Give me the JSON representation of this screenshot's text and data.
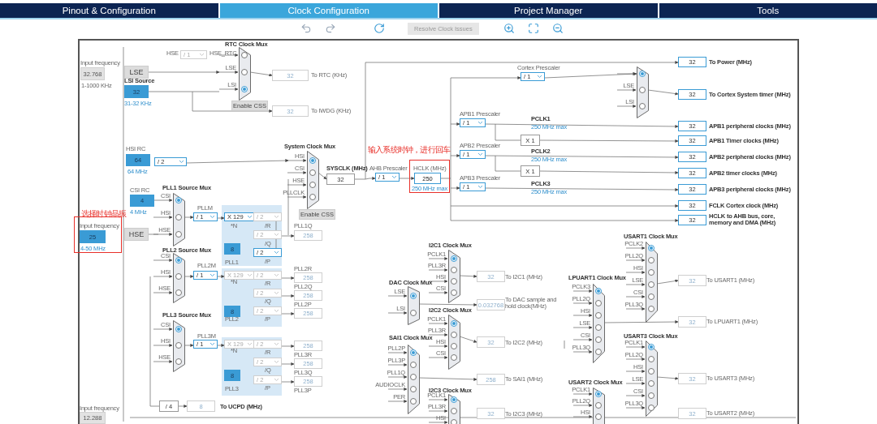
{
  "tabs": [
    {
      "label": "Pinout & Configuration",
      "selected": false
    },
    {
      "label": "Clock Configuration",
      "selected": true
    },
    {
      "label": "Project Manager",
      "selected": false
    },
    {
      "label": "Tools",
      "selected": false
    }
  ],
  "toolbar": {
    "resolve_button": {
      "label": "Resolve Clock Issues",
      "disabled": true
    }
  },
  "annotations": [
    "选择时钟晶振",
    "输入系统时钟，进行回车"
  ],
  "labels": [
    {
      "text": "Input frequency",
      "kind": "caption"
    },
    {
      "text": "1-1000 KHz",
      "kind": "caption"
    },
    {
      "text": "LSI Source",
      "kind": "title"
    },
    {
      "text": "31-32 KHz",
      "kind": "hint"
    },
    {
      "text": "HSE",
      "kind": "caption"
    },
    {
      "text": "HSE_RTC",
      "kind": "caption"
    },
    {
      "text": "To RTC (KHz)",
      "kind": "caption"
    },
    {
      "text": "To IWDG (KHz)",
      "kind": "caption"
    },
    {
      "text": "HSI RC",
      "kind": "caption"
    },
    {
      "text": "64 MHz",
      "kind": "hint"
    },
    {
      "text": "CSI RC",
      "kind": "caption"
    },
    {
      "text": "4 MHz",
      "kind": "hint"
    },
    {
      "text": "Input frequency",
      "kind": "caption"
    },
    {
      "text": "4-50 MHz",
      "kind": "hint"
    },
    {
      "text": "SYSCLK (MHz)",
      "kind": "title"
    },
    {
      "text": "PLLM",
      "kind": "caption"
    },
    {
      "text": "*N",
      "kind": "caption"
    },
    {
      "text": "/R",
      "kind": "caption"
    },
    {
      "text": "/Q",
      "kind": "caption"
    },
    {
      "text": "/P",
      "kind": "caption"
    },
    {
      "text": "PLL1",
      "kind": "caption"
    },
    {
      "text": "PLL1Q",
      "kind": "caption"
    },
    {
      "text": "AHB Prescaler",
      "kind": "caption"
    },
    {
      "text": "HCLK (MHz)",
      "kind": "caption"
    },
    {
      "text": "250 MHz max",
      "kind": "hint"
    },
    {
      "text": "Cortex Prescaler",
      "kind": "caption"
    },
    {
      "text": "APB1 Prescaler",
      "kind": "caption"
    },
    {
      "text": "PCLK1",
      "kind": "title"
    },
    {
      "text": "250 MHz max",
      "kind": "hint"
    },
    {
      "text": "APB2 Prescaler",
      "kind": "caption"
    },
    {
      "text": "PCLK2",
      "kind": "title"
    },
    {
      "text": "250 MHz max",
      "kind": "hint"
    },
    {
      "text": "APB3 Prescaler",
      "kind": "caption"
    },
    {
      "text": "PCLK3",
      "kind": "title"
    },
    {
      "text": "250 MHz max",
      "kind": "hint"
    },
    {
      "text": "To Power (MHz)",
      "kind": "output"
    },
    {
      "text": "To Cortex System timer (MHz)",
      "kind": "output"
    },
    {
      "text": "APB1 peripheral clocks (MHz)",
      "kind": "output"
    },
    {
      "text": "APB1 Timer clocks (MHz)",
      "kind": "output"
    },
    {
      "text": "APB2 peripheral clocks (MHz)",
      "kind": "output"
    },
    {
      "text": "APB2 timer clocks (MHz)",
      "kind": "output"
    },
    {
      "text": "APB3 peripheral clocks (MHz)",
      "kind": "output"
    },
    {
      "text": "FCLK Cortex clock (MHz)",
      "kind": "output"
    },
    {
      "text": "HCLK to AHB bus, core, memory and DMA (MHz)",
      "kind": "output"
    },
    {
      "text": "PLL2M",
      "kind": "caption"
    },
    {
      "text": "*N",
      "kind": "caption"
    },
    {
      "text": "/R",
      "kind": "caption"
    },
    {
      "text": "/Q",
      "kind": "caption"
    },
    {
      "text": "PLL2",
      "kind": "caption"
    },
    {
      "text": "/P",
      "kind": "caption"
    },
    {
      "text": "PLL2R",
      "kind": "caption"
    },
    {
      "text": "PLL2Q",
      "kind": "caption"
    },
    {
      "text": "PLL2P",
      "kind": "caption"
    },
    {
      "text": "PLL3M",
      "kind": "caption"
    },
    {
      "text": "*N",
      "kind": "caption"
    },
    {
      "text": "/R",
      "kind": "caption"
    },
    {
      "text": "/Q",
      "kind": "caption"
    },
    {
      "text": "PLL3",
      "kind": "caption"
    },
    {
      "text": "/P",
      "kind": "caption"
    },
    {
      "text": "PLL3R",
      "kind": "caption"
    },
    {
      "text": "PLL3Q",
      "kind": "caption"
    },
    {
      "text": "PLL3P",
      "kind": "caption"
    },
    {
      "text": "Input frequency",
      "kind": "caption"
    },
    {
      "text": "To UCPD (MHz)",
      "kind": "title"
    },
    {
      "text": "To I2C1 (MHz)",
      "kind": "caption"
    },
    {
      "text": "To DAC sample and hold clock(MHz)",
      "kind": "caption"
    },
    {
      "text": "To I2C2 (MHz)",
      "kind": "caption"
    },
    {
      "text": "To SAI1 (MHz)",
      "kind": "caption"
    },
    {
      "text": "To I2C3 (MHz)",
      "kind": "caption"
    },
    {
      "text": "To USART1 (MHz)",
      "kind": "caption"
    },
    {
      "text": "To LPUART1 (MHz)",
      "kind": "caption"
    },
    {
      "text": "To USART3 (MHz)",
      "kind": "caption"
    },
    {
      "text": "To USART2 (MHz)",
      "kind": "caption"
    }
  ],
  "value_boxes": [
    {
      "value": "32.768",
      "kind": "fixed"
    },
    {
      "value": "LSE",
      "kind": "grey"
    },
    {
      "value": "32",
      "kind": "source"
    },
    {
      "value": "32",
      "kind": "inactive"
    },
    {
      "value": "Enable CSS",
      "kind": "grey"
    },
    {
      "value": "32",
      "kind": "inactive"
    },
    {
      "value": "64",
      "kind": "source"
    },
    {
      "value": "4",
      "kind": "source"
    },
    {
      "value": "25",
      "kind": "source"
    },
    {
      "value": "HSE",
      "kind": "grey"
    },
    {
      "value": "Enable CSS",
      "kind": "grey"
    },
    {
      "value": "32",
      "kind": "plain"
    },
    {
      "value": "250",
      "kind": "input"
    },
    {
      "value": "8",
      "kind": "source"
    },
    {
      "value": "258",
      "kind": "inactive"
    },
    {
      "value": "X 1",
      "kind": "plain"
    },
    {
      "value": "X 1",
      "kind": "plain"
    },
    {
      "value": "32",
      "kind": "output"
    },
    {
      "value": "32",
      "kind": "output"
    },
    {
      "value": "32",
      "kind": "output"
    },
    {
      "value": "32",
      "kind": "output"
    },
    {
      "value": "32",
      "kind": "output"
    },
    {
      "value": "32",
      "kind": "output"
    },
    {
      "value": "32",
      "kind": "output"
    },
    {
      "value": "32",
      "kind": "output"
    },
    {
      "value": "32",
      "kind": "output"
    },
    {
      "value": "8",
      "kind": "source"
    },
    {
      "value": "258",
      "kind": "inactive"
    },
    {
      "value": "258",
      "kind": "inactive"
    },
    {
      "value": "258",
      "kind": "inactive"
    },
    {
      "value": "8",
      "kind": "source"
    },
    {
      "value": "258",
      "kind": "inactive"
    },
    {
      "value": "258",
      "kind": "inactive"
    },
    {
      "value": "258",
      "kind": "inactive"
    },
    {
      "value": "/ 4",
      "kind": "plain"
    },
    {
      "value": "8",
      "kind": "inactive"
    },
    {
      "value": "12.288",
      "kind": "fixed"
    },
    {
      "value": "32",
      "kind": "inactive"
    },
    {
      "value": "0.032768",
      "kind": "inactive"
    },
    {
      "value": "32",
      "kind": "inactive"
    },
    {
      "value": "258",
      "kind": "inactive"
    },
    {
      "value": "32",
      "kind": "inactive"
    },
    {
      "value": "32",
      "kind": "inactive"
    },
    {
      "value": "32",
      "kind": "inactive"
    },
    {
      "value": "32",
      "kind": "inactive"
    },
    {
      "value": "32",
      "kind": "inactive"
    }
  ],
  "dropdowns": [
    {
      "value": "/ 1",
      "disabled": true
    },
    {
      "value": "/ 2",
      "disabled": false
    },
    {
      "value": "/ 1",
      "disabled": false
    },
    {
      "value": "X 129",
      "disabled": false
    },
    {
      "value": "/ 2",
      "disabled": true
    },
    {
      "value": "/ 2",
      "disabled": true
    },
    {
      "value": "/ 2",
      "disabled": false
    },
    {
      "value": "/ 1",
      "disabled": false
    },
    {
      "value": "/ 1",
      "disabled": false
    },
    {
      "value": "/ 1",
      "disabled": false
    },
    {
      "value": "/ 1",
      "disabled": false
    },
    {
      "value": "/ 1",
      "disabled": false
    },
    {
      "value": "/ 1",
      "disabled": false
    },
    {
      "value": "X 129",
      "disabled": true
    },
    {
      "value": "/ 2",
      "disabled": true
    },
    {
      "value": "/ 2",
      "disabled": true
    },
    {
      "value": "/ 2",
      "disabled": true
    },
    {
      "value": "/ 1",
      "disabled": false
    },
    {
      "value": "X 129",
      "disabled": true
    },
    {
      "value": "/ 2",
      "disabled": true
    },
    {
      "value": "/ 2",
      "disabled": true
    },
    {
      "value": "/ 2",
      "disabled": true
    }
  ],
  "muxes": [
    {
      "title": "RTC Clock Mux",
      "inputs": [
        {
          "selected": false
        },
        {
          "label": "LSE",
          "selected": false
        },
        {
          "label": "LSI",
          "selected": true
        }
      ]
    },
    {
      "title": "System Clock Mux",
      "inputs": [
        {
          "label": "HSI",
          "selected": true
        },
        {
          "label": "CSI",
          "selected": false
        },
        {
          "label": "HSE",
          "selected": false
        },
        {
          "label": "PLLCLK",
          "selected": false
        }
      ]
    },
    {
      "title": "PLL1 Source Mux",
      "inputs": [
        {
          "label": "CSI",
          "selected": true
        },
        {
          "label": "HSI",
          "selected": false
        },
        {
          "label": "HSE",
          "selected": false
        }
      ]
    },
    {
      "title": "PLL2 Source Mux",
      "inputs": [
        {
          "label": "CSI",
          "selected": true
        },
        {
          "label": "HSI",
          "selected": false
        },
        {
          "label": "HSE",
          "selected": false
        }
      ]
    },
    {
      "title": "PLL3 Source Mux",
      "inputs": [
        {
          "label": "CSI",
          "selected": true
        },
        {
          "label": "HSI",
          "selected": false
        },
        {
          "label": "HSE",
          "selected": false
        }
      ]
    },
    {
      "inputs": [
        {
          "selected": true
        },
        {
          "label": "LSE",
          "selected": false
        },
        {
          "label": "LSI",
          "selected": false
        }
      ]
    },
    {
      "title": "I2C1 Clock Mux",
      "inputs": [
        {
          "label": "PCLK1",
          "selected": true
        },
        {
          "label": "PLL3R",
          "selected": false
        },
        {
          "label": "HSI",
          "selected": false
        },
        {
          "label": "CSI",
          "selected": false
        }
      ]
    },
    {
      "title": "DAC Clock Mux",
      "inputs": [
        {
          "label": "LSE",
          "selected": true
        },
        {
          "label": "LSI",
          "selected": false
        }
      ]
    },
    {
      "title": "I2C2 Clock Mux",
      "inputs": [
        {
          "label": "PCLK1",
          "selected": true
        },
        {
          "label": "PLL3R",
          "selected": false
        },
        {
          "label": "HSI",
          "selected": false
        },
        {
          "label": "CSI",
          "selected": false
        }
      ]
    },
    {
      "title": "SAI1 Clock Mux",
      "inputs": [
        {
          "label": "PLL2P",
          "selected": true
        },
        {
          "label": "PLL3P",
          "selected": false
        },
        {
          "label": "PLL1Q",
          "selected": false
        },
        {
          "label": "AUDIOCLK",
          "selected": false
        },
        {
          "label": "PER",
          "selected": false
        }
      ]
    },
    {
      "title": "I2C3 Clock Mux",
      "inputs": [
        {
          "label": "PCLK1",
          "selected": true
        },
        {
          "label": "PLL3R",
          "selected": false
        },
        {
          "label": "HSI",
          "selected": false
        }
      ]
    },
    {
      "title": "USART1 Clock Mux",
      "inputs": [
        {
          "label": "PCLK2",
          "selected": true
        },
        {
          "label": "PLL2Q",
          "selected": false
        },
        {
          "label": "HSI",
          "selected": false
        },
        {
          "label": "LSE",
          "selected": false
        },
        {
          "label": "CSI",
          "selected": false
        },
        {
          "label": "PLL3Q",
          "selected": false
        }
      ]
    },
    {
      "title": "LPUART1 Clock Mux",
      "inputs": [
        {
          "label": "PCLK3",
          "selected": true
        },
        {
          "label": "PLL2Q",
          "selected": false
        },
        {
          "label": "HSI",
          "selected": false
        },
        {
          "label": "LSE",
          "selected": false
        },
        {
          "label": "CSI",
          "selected": false
        },
        {
          "label": "PLL3Q",
          "selected": false
        }
      ]
    },
    {
      "title": "USART3 Clock Mux",
      "inputs": [
        {
          "label": "PCLK1",
          "selected": true
        },
        {
          "label": "PLL2Q",
          "selected": false
        },
        {
          "label": "HSI",
          "selected": false
        },
        {
          "label": "LSE",
          "selected": false
        },
        {
          "label": "CSI",
          "selected": false
        },
        {
          "label": "PLL3Q",
          "selected": false
        }
      ]
    },
    {
      "title": "USART2 Clock Mux",
      "inputs": [
        {
          "label": "PCLK1",
          "selected": true
        },
        {
          "label": "PLL2Q",
          "selected": false
        },
        {
          "label": "HSI",
          "selected": false
        }
      ]
    }
  ]
}
